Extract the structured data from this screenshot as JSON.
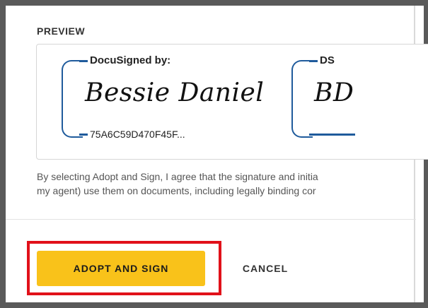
{
  "preview": {
    "label": "PREVIEW",
    "signature": {
      "header": "DocuSigned by:",
      "name": "Bessie Daniel",
      "id": "75A6C59D470F45F..."
    },
    "initials": {
      "header": "DS",
      "value": "BD"
    }
  },
  "disclaimer": {
    "line1": "By selecting Adopt and Sign, I agree that the signature and initia",
    "line2": "my agent) use them on documents, including legally binding cor"
  },
  "actions": {
    "adopt_label": "ADOPT AND SIGN",
    "cancel_label": "CANCEL"
  },
  "colors": {
    "accent": "#f9c21a",
    "bracket": "#1f5b9c",
    "highlight": "#e1111a"
  }
}
